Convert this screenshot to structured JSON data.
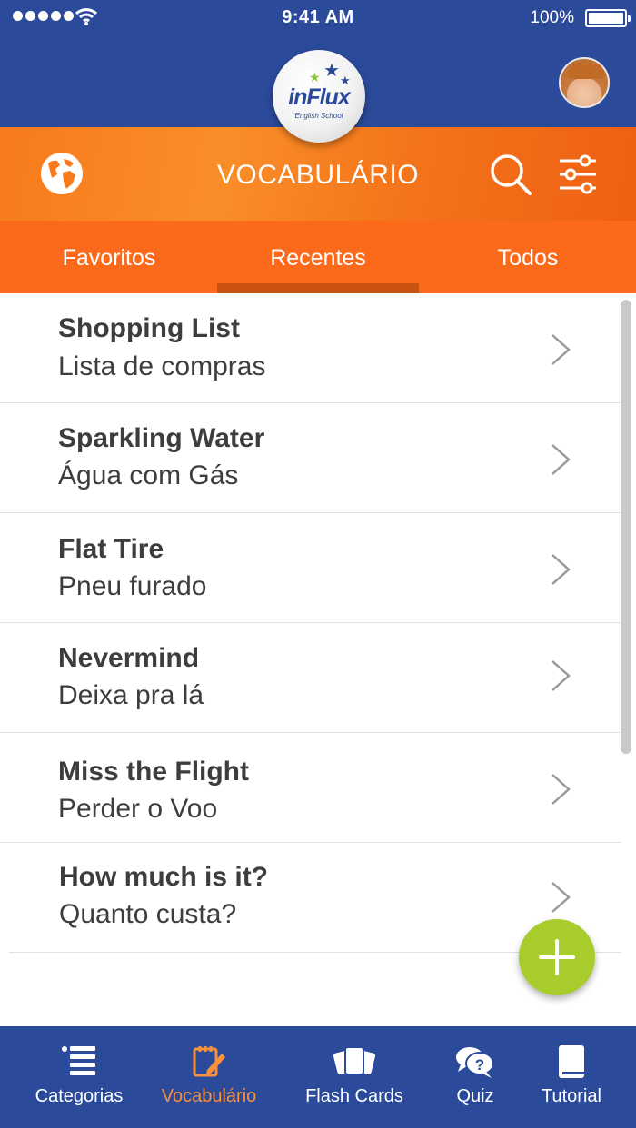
{
  "status_bar": {
    "time": "9:41 AM",
    "battery": "100%"
  },
  "header": {
    "logo_text": "inFlux",
    "logo_sub": "English School",
    "title": "VOCABULÁRIO"
  },
  "tabs": [
    {
      "label": "Favoritos",
      "active": false
    },
    {
      "label": "Recentes",
      "active": true
    },
    {
      "label": "Todos",
      "active": false
    }
  ],
  "items": [
    {
      "term": "Shopping List",
      "translation": "Lista de compras"
    },
    {
      "term": "Sparkling Water",
      "translation": "Água com Gás"
    },
    {
      "term": "Flat Tire",
      "translation": "Pneu furado"
    },
    {
      "term": "Nevermind",
      "translation": "Deixa pra lá"
    },
    {
      "term": "Miss the Flight",
      "translation": "Perder o Voo"
    },
    {
      "term": "How much is it?",
      "translation": "Quanto custa?"
    }
  ],
  "bottom_nav": [
    {
      "label": "Categorias",
      "icon": "list-icon",
      "active": false
    },
    {
      "label": "Vocabulário",
      "icon": "notepad-pencil-icon",
      "active": true
    },
    {
      "label": "Flash Cards",
      "icon": "cards-icon",
      "active": false
    },
    {
      "label": "Quiz",
      "icon": "chat-question-icon",
      "active": false
    },
    {
      "label": "Tutorial",
      "icon": "book-icon",
      "active": false
    }
  ],
  "colors": {
    "header_blue": "#2b4a9a",
    "accent_orange": "#fb6a1a",
    "tab_indicator": "#c9520f",
    "fab_green": "#a9cc2d",
    "active_nav": "#f7913d"
  }
}
